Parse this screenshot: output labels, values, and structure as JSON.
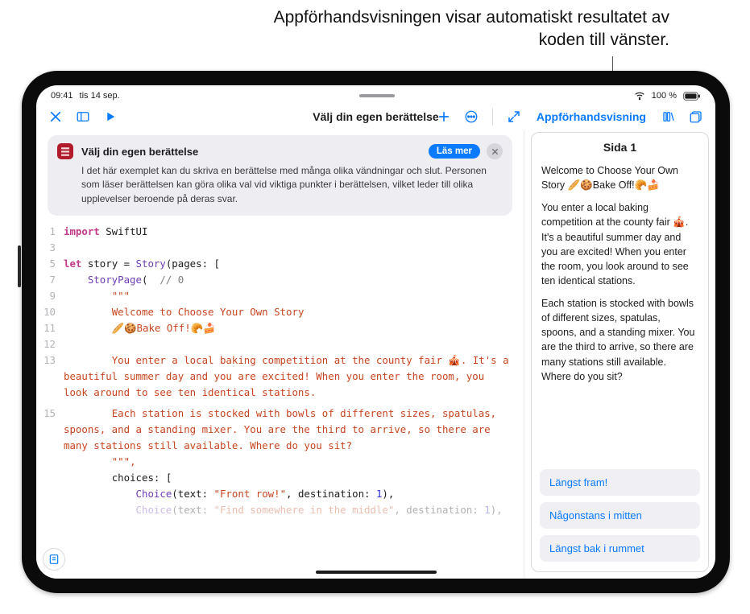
{
  "annotation": "Appförhandsvisningen visar automatiskt resultatet av koden till vänster.",
  "status": {
    "time": "09:41",
    "date": "tis 14 sep.",
    "battery_pct": "100 %"
  },
  "navbar": {
    "title": "Välj din egen berättelse",
    "preview_label": "Appförhandsvisning"
  },
  "info_card": {
    "title": "Välj din egen berättelse",
    "learn_more": "Läs mer",
    "body": "I det här exemplet kan du skriva en berättelse med många olika vändningar och slut. Personen som läser berättelsen kan göra olika val vid viktiga punkter i berättelsen, vilket leder till olika upplevelser beroende på deras svar."
  },
  "code": {
    "l1": "import",
    "l1b": " SwiftUI",
    "l3_empty": "",
    "l5a": "let",
    "l5b": " story = ",
    "l5c": "Story",
    "l5d": "(pages: [",
    "l7a": "    ",
    "l7b": "StoryPage",
    "l7c": "(  ",
    "l7d": "// 0",
    "l9": "        \"\"\"",
    "l10": "        Welcome to Choose Your Own Story",
    "l11": "        🥖🍪Bake Off!🥐🍰",
    "l12_empty": "",
    "l13": "        You enter a local baking competition at the county fair 🎪. It's a beautiful summer day and you are excited! When you enter the room, you look around to see ten identical stations.",
    "l15": "        Each station is stocked with bowls of different sizes, spatulas, spoons, and a standing mixer. You are the third to arrive, so there are many stations still available. Where do you sit?",
    "l_end": "        \"\"\",",
    "l_choices": "        choices: [",
    "l_c1a": "            ",
    "l_c1b": "Choice",
    "l_c1c": "(text: ",
    "l_c1d": "\"Front row!\"",
    "l_c1e": ", destination: ",
    "l_c1f": "1",
    "l_c1g": "),",
    "l_c2a": "            ",
    "l_c2b": "Choice",
    "l_c2c": "(text: ",
    "l_c2d": "\"Find somewhere in the middle\"",
    "l_c2e": ", destination: ",
    "l_c2f": "1",
    "l_c2g": "),"
  },
  "line_numbers": {
    "n1": "1",
    "n3": "3",
    "n5": "5",
    "n7": "7",
    "n9": "9",
    "n10": "10",
    "n11": "11",
    "n12": "12",
    "n13": "13",
    "n15": "15"
  },
  "preview": {
    "title": "Sida 1",
    "p1": "Welcome to Choose Your Own Story 🥖🍪Bake Off!🥐🍰",
    "p2": "You enter a local baking competition at the county fair 🎪. It's a beautiful summer day and you are excited! When you enter the room, you look around to see ten identical stations.",
    "p3": "Each station is stocked with bowls of different sizes, spatulas, spoons, and a standing mixer. You are the third to arrive, so there are many stations still available. Where do you sit?",
    "choices": {
      "c1": "Längst fram!",
      "c2": "Någonstans i mitten",
      "c3": "Längst bak i rummet"
    }
  }
}
